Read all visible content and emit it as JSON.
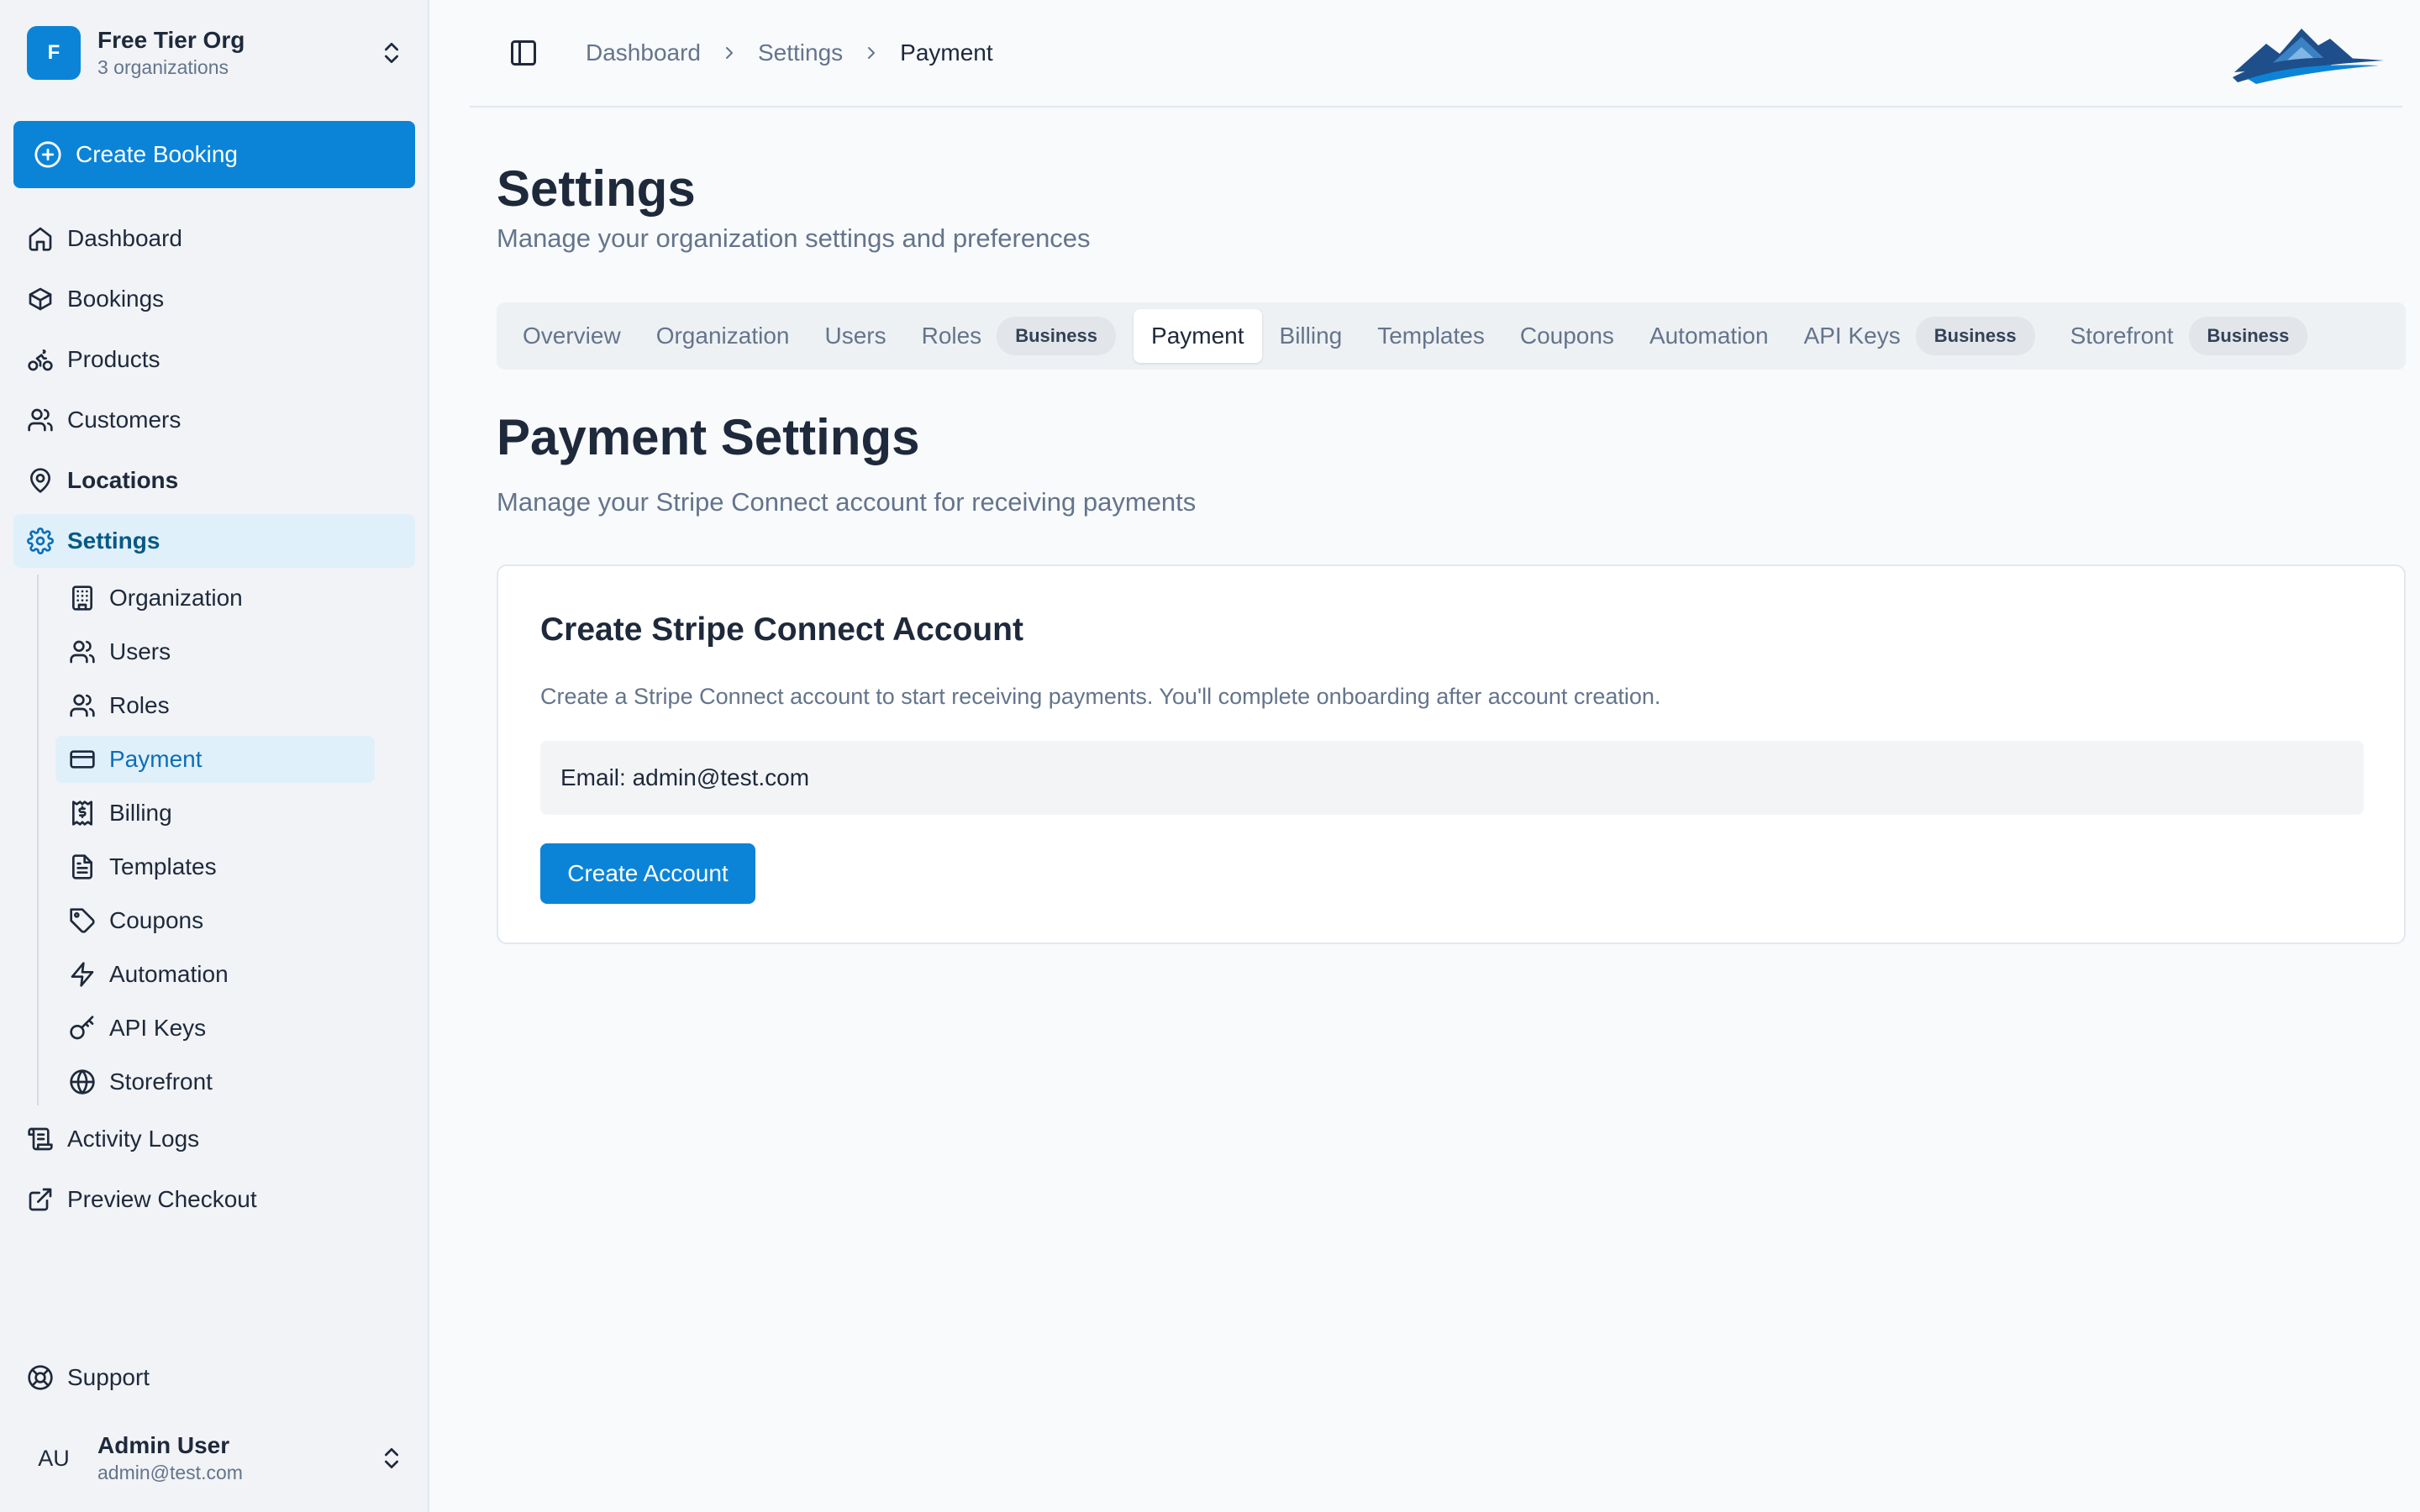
{
  "org": {
    "initial": "F",
    "name": "Free Tier Org",
    "subtitle": "3 organizations"
  },
  "sidebar": {
    "create_booking_label": "Create Booking",
    "items": [
      {
        "label": "Dashboard",
        "icon": "home-icon"
      },
      {
        "label": "Bookings",
        "icon": "box-icon"
      },
      {
        "label": "Products",
        "icon": "bike-icon"
      },
      {
        "label": "Customers",
        "icon": "users-icon"
      },
      {
        "label": "Locations",
        "icon": "map-pin-icon"
      },
      {
        "label": "Settings",
        "icon": "gear-icon"
      }
    ],
    "settings_items": [
      {
        "label": "Organization",
        "icon": "building-icon"
      },
      {
        "label": "Users",
        "icon": "users-icon"
      },
      {
        "label": "Roles",
        "icon": "users-icon"
      },
      {
        "label": "Payment",
        "icon": "credit-card-icon"
      },
      {
        "label": "Billing",
        "icon": "receipt-icon"
      },
      {
        "label": "Templates",
        "icon": "file-text-icon"
      },
      {
        "label": "Coupons",
        "icon": "tag-icon"
      },
      {
        "label": "Automation",
        "icon": "zap-icon"
      },
      {
        "label": "API Keys",
        "icon": "key-icon"
      },
      {
        "label": "Storefront",
        "icon": "globe-icon"
      }
    ],
    "bottom_items": [
      {
        "label": "Activity Logs",
        "icon": "scroll-icon"
      },
      {
        "label": "Preview Checkout",
        "icon": "external-link-icon"
      }
    ],
    "support_label": "Support"
  },
  "user": {
    "initials": "AU",
    "name": "Admin User",
    "email": "admin@test.com"
  },
  "breadcrumb": [
    "Dashboard",
    "Settings",
    "Payment"
  ],
  "page": {
    "title": "Settings",
    "subtitle": "Manage your organization settings and preferences"
  },
  "tabs": [
    {
      "label": "Overview"
    },
    {
      "label": "Organization"
    },
    {
      "label": "Users"
    },
    {
      "label": "Roles",
      "badge": "Business"
    },
    {
      "label": "Payment",
      "active": true
    },
    {
      "label": "Billing"
    },
    {
      "label": "Templates"
    },
    {
      "label": "Coupons"
    },
    {
      "label": "Automation"
    },
    {
      "label": "API Keys",
      "badge": "Business"
    },
    {
      "label": "Storefront",
      "badge": "Business"
    }
  ],
  "payment": {
    "title": "Payment Settings",
    "subtitle": "Manage your Stripe Connect account for receiving payments",
    "card": {
      "title": "Create Stripe Connect Account",
      "description": "Create a Stripe Connect account to start receiving payments. You'll complete onboarding after account creation.",
      "email_text": "Email: admin@test.com",
      "button_label": "Create Account"
    }
  },
  "colors": {
    "accent": "#0b84d8",
    "active_bg": "#e0f0fb"
  }
}
